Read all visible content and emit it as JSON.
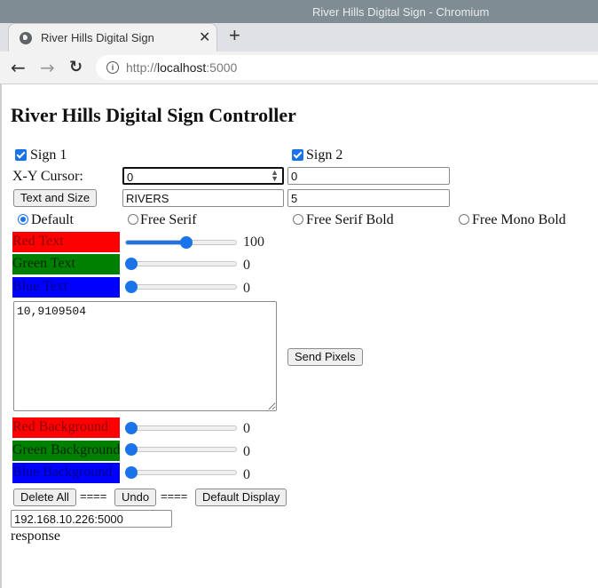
{
  "window": {
    "title": "River Hills Digital Sign - Chromium"
  },
  "tab": {
    "title": "River Hills Digital Sign"
  },
  "address_bar": {
    "url_prefix": "http://",
    "url_host": "localhost",
    "url_port": ":5000"
  },
  "page": {
    "heading": "River Hills Digital Sign Controller",
    "signs": [
      {
        "label": "Sign 1",
        "checked": true
      },
      {
        "label": "Sign 2",
        "checked": true
      }
    ],
    "cursor": {
      "label": "X-Y Cursor:",
      "x_value": "0",
      "y_value": "0"
    },
    "text_and_size": {
      "button_label": "Text and Size",
      "text_value": "RIVERS",
      "size_value": "5"
    },
    "fonts": {
      "selected": "Default",
      "options": [
        "Default",
        "Free Serif",
        "Free Serif Bold",
        "Free Mono Bold"
      ]
    },
    "text_color": [
      {
        "label": "Red Text",
        "value": 100,
        "color": "#ff0000",
        "fill_fraction": 0.55
      },
      {
        "label": "Green Text",
        "value": 0,
        "color": "#008000",
        "fill_fraction": 0
      },
      {
        "label": "Blue Text",
        "value": 0,
        "color": "#0000ff",
        "fill_fraction": 0
      }
    ],
    "pixels": {
      "textarea_value": "10,9109504",
      "send_button": "Send Pixels"
    },
    "background_color": [
      {
        "label": "Red Background",
        "value": 0,
        "color": "#ff0000",
        "fill_fraction": 0
      },
      {
        "label": "Green Background",
        "value": 0,
        "color": "#008000",
        "fill_fraction": 0
      },
      {
        "label": "Blue Background",
        "value": 0,
        "color": "#0000ff",
        "fill_fraction": 0
      }
    ],
    "actions": {
      "delete_all": "Delete All",
      "separator": "====",
      "undo": "Undo",
      "default_display": "Default Display"
    },
    "server_address": "192.168.10.226:5000",
    "response_text": "response"
  }
}
